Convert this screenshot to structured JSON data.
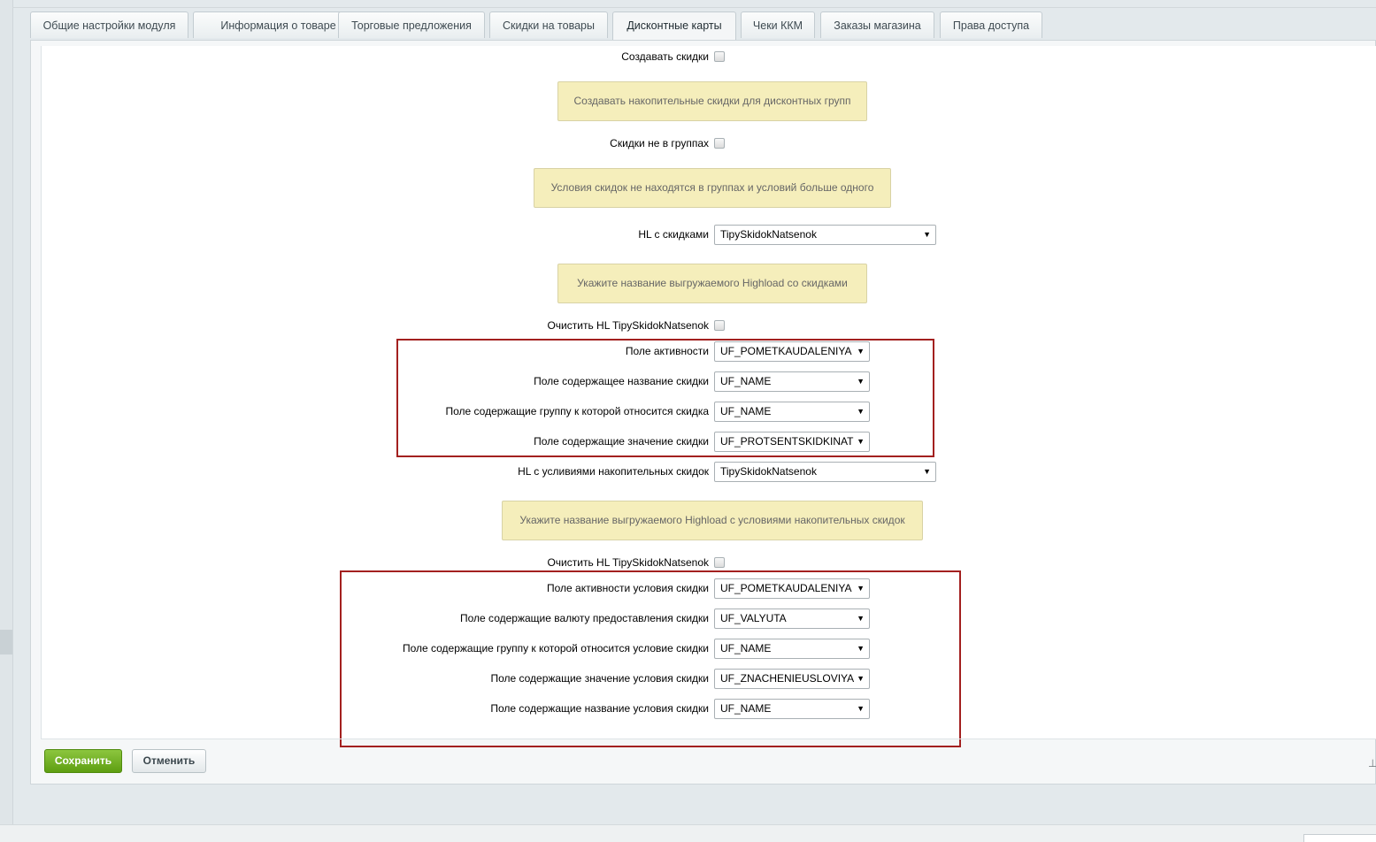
{
  "tabs": [
    {
      "label": "Общие настройки модуля"
    },
    {
      "label": "Информация о товаре"
    },
    {
      "label": "Торговые предложения"
    },
    {
      "label": "Скидки на товары"
    },
    {
      "label": "Дисконтные карты"
    },
    {
      "label": "Чеки ККМ"
    },
    {
      "label": "Заказы магазина"
    },
    {
      "label": "Права доступа"
    }
  ],
  "active_tab": "Дисконтные карты",
  "form": {
    "create_discounts": {
      "label": "Создавать скидки",
      "checked": false
    },
    "create_discounts_note": "Создавать накопительные скидки для дисконтных групп",
    "discounts_not_in_groups": {
      "label": "Скидки не в группах",
      "checked": false
    },
    "discounts_not_in_groups_note": "Условия скидок не находятся в группах и условий больше одного",
    "hl_discounts": {
      "label": "HL с скидками",
      "value": "TipySkidokNatsenok"
    },
    "hl_discounts_note": "Укажите название выгружаемого Highload со скидками",
    "clear_hl_1": {
      "label": "Очистить HL TipySkidokNatsenok",
      "checked": false
    },
    "group1": [
      {
        "label": "Поле активности",
        "value": "UF_POMETKAUDALENIYA"
      },
      {
        "label": "Поле содержащее название скидки",
        "value": "UF_NAME"
      },
      {
        "label": "Поле содержащие группу к которой относится скидка",
        "value": "UF_NAME"
      },
      {
        "label": "Поле содержащие значение скидки",
        "value": "UF_PROTSENTSKIDKINAT"
      }
    ],
    "hl_conditions": {
      "label": "HL с усливиями накопительных скидок",
      "value": "TipySkidokNatsenok"
    },
    "hl_conditions_note": "Укажите название выгружаемого Highload с условиями накопительных скидок",
    "clear_hl_2": {
      "label": "Очистить HL TipySkidokNatsenok",
      "checked": false
    },
    "group2": [
      {
        "label": "Поле активности условия скидки",
        "value": "UF_POMETKAUDALENIYA"
      },
      {
        "label": "Поле содержащие валюту предоставления скидки",
        "value": "UF_VALYUTA"
      },
      {
        "label": "Поле содержащие группу к которой относится условие скидки",
        "value": "UF_NAME"
      },
      {
        "label": "Поле содержащие значение условия скидки",
        "value": "UF_ZNACHENIEUSLOVIYA"
      },
      {
        "label": "Поле содержащие название условия скидки",
        "value": "UF_NAME"
      }
    ]
  },
  "buttons": {
    "save": "Сохранить",
    "cancel": "Отменить"
  },
  "icons": {
    "select_arrow": "▼",
    "pin": "pin-icon"
  },
  "colors": {
    "highlight_border": "#a3201f",
    "note_background": "#f5eebb",
    "save_button": "#6fae1f"
  }
}
